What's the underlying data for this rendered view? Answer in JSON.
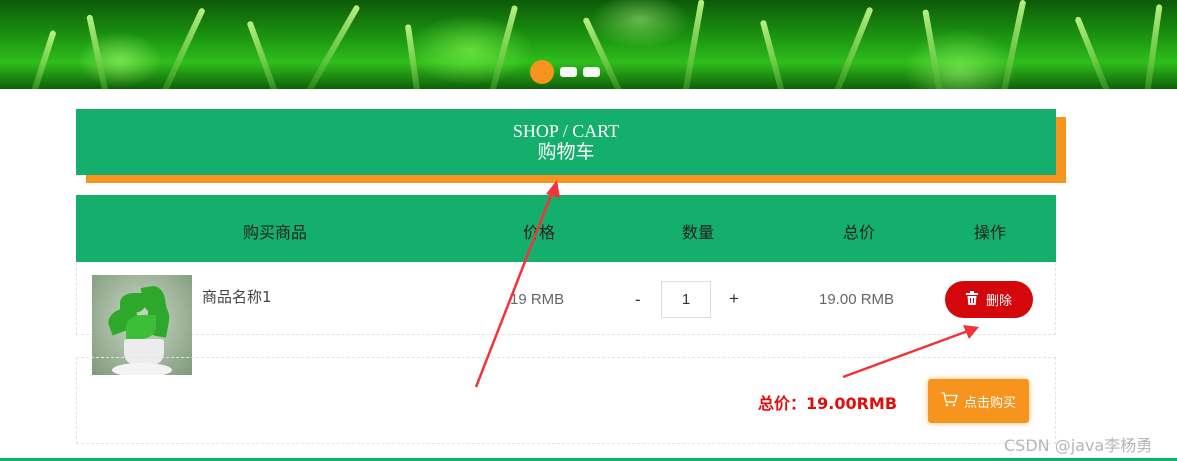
{
  "banner": {
    "carousel_dots": 3,
    "active_dot": 0,
    "colors": {
      "active_dot": "#f7941d",
      "dot": "#ffffff"
    }
  },
  "title": {
    "en": "SHOP / CART",
    "cn": "购物车"
  },
  "table": {
    "headers": [
      "购买商品",
      "价格",
      "数量",
      "总价",
      "操作"
    ]
  },
  "item": {
    "name": "商品名称1",
    "price": "19 RMB",
    "quantity": "1",
    "minus_label": "-",
    "plus_label": "+",
    "subtotal": "19.00 RMB",
    "delete_label": "删除",
    "delete_icon": "trash-icon"
  },
  "footer": {
    "total_text": "总价：19.00RMB",
    "buy_label": "点击购买",
    "buy_icon": "cart-icon"
  },
  "watermark": "CSDN @java李杨勇",
  "colors": {
    "green": "#14af6c",
    "orange": "#f7941d",
    "delete_red": "#d4080c",
    "total_red": "#e10d0d",
    "arrow_red": "#f0343a"
  }
}
